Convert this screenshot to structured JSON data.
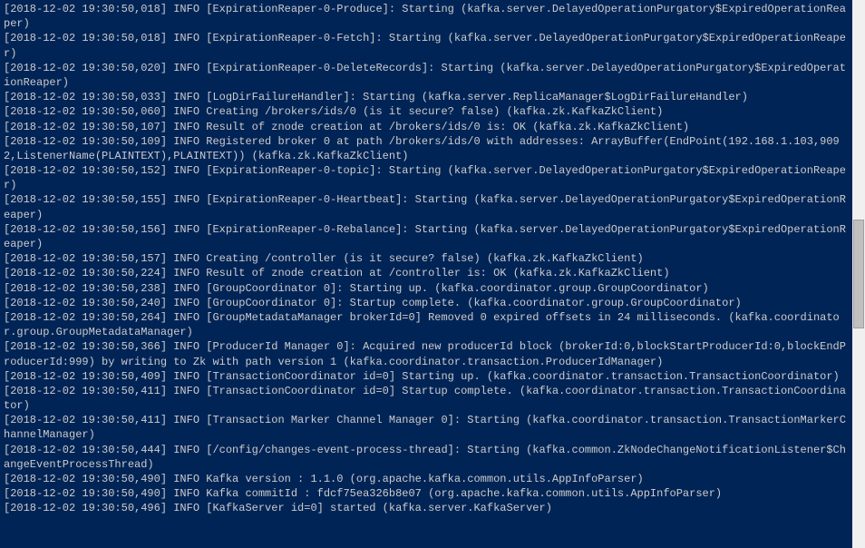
{
  "log_lines": [
    "[2018-12-02 19:30:50,018] INFO [ExpirationReaper-0-Produce]: Starting (kafka.server.DelayedOperationPurgatory$ExpiredOperationReaper)",
    "[2018-12-02 19:30:50,018] INFO [ExpirationReaper-0-Fetch]: Starting (kafka.server.DelayedOperationPurgatory$ExpiredOperationReaper)",
    "[2018-12-02 19:30:50,020] INFO [ExpirationReaper-0-DeleteRecords]: Starting (kafka.server.DelayedOperationPurgatory$ExpiredOperationReaper)",
    "[2018-12-02 19:30:50,033] INFO [LogDirFailureHandler]: Starting (kafka.server.ReplicaManager$LogDirFailureHandler)",
    "[2018-12-02 19:30:50,060] INFO Creating /brokers/ids/0 (is it secure? false) (kafka.zk.KafkaZkClient)",
    "[2018-12-02 19:30:50,107] INFO Result of znode creation at /brokers/ids/0 is: OK (kafka.zk.KafkaZkClient)",
    "[2018-12-02 19:30:50,109] INFO Registered broker 0 at path /brokers/ids/0 with addresses: ArrayBuffer(EndPoint(192.168.1.103,9092,ListenerName(PLAINTEXT),PLAINTEXT)) (kafka.zk.KafkaZkClient)",
    "[2018-12-02 19:30:50,152] INFO [ExpirationReaper-0-topic]: Starting (kafka.server.DelayedOperationPurgatory$ExpiredOperationReaper)",
    "[2018-12-02 19:30:50,155] INFO [ExpirationReaper-0-Heartbeat]: Starting (kafka.server.DelayedOperationPurgatory$ExpiredOperationReaper)",
    "[2018-12-02 19:30:50,156] INFO [ExpirationReaper-0-Rebalance]: Starting (kafka.server.DelayedOperationPurgatory$ExpiredOperationReaper)",
    "[2018-12-02 19:30:50,157] INFO Creating /controller (is it secure? false) (kafka.zk.KafkaZkClient)",
    "[2018-12-02 19:30:50,224] INFO Result of znode creation at /controller is: OK (kafka.zk.KafkaZkClient)",
    "[2018-12-02 19:30:50,238] INFO [GroupCoordinator 0]: Starting up. (kafka.coordinator.group.GroupCoordinator)",
    "[2018-12-02 19:30:50,240] INFO [GroupCoordinator 0]: Startup complete. (kafka.coordinator.group.GroupCoordinator)",
    "[2018-12-02 19:30:50,264] INFO [GroupMetadataManager brokerId=0] Removed 0 expired offsets in 24 milliseconds. (kafka.coordinator.group.GroupMetadataManager)",
    "[2018-12-02 19:30:50,366] INFO [ProducerId Manager 0]: Acquired new producerId block (brokerId:0,blockStartProducerId:0,blockEndProducerId:999) by writing to Zk with path version 1 (kafka.coordinator.transaction.ProducerIdManager)",
    "[2018-12-02 19:30:50,409] INFO [TransactionCoordinator id=0] Starting up. (kafka.coordinator.transaction.TransactionCoordinator)",
    "[2018-12-02 19:30:50,411] INFO [TransactionCoordinator id=0] Startup complete. (kafka.coordinator.transaction.TransactionCoordinator)",
    "[2018-12-02 19:30:50,411] INFO [Transaction Marker Channel Manager 0]: Starting (kafka.coordinator.transaction.TransactionMarkerChannelManager)",
    "[2018-12-02 19:30:50,444] INFO [/config/changes-event-process-thread]: Starting (kafka.common.ZkNodeChangeNotificationListener$ChangeEventProcessThread)",
    "[2018-12-02 19:30:50,490] INFO Kafka version : 1.1.0 (org.apache.kafka.common.utils.AppInfoParser)",
    "[2018-12-02 19:30:50,490] INFO Kafka commitId : fdcf75ea326b8e07 (org.apache.kafka.common.utils.AppInfoParser)",
    "[2018-12-02 19:30:50,496] INFO [KafkaServer id=0] started (kafka.server.KafkaServer)"
  ]
}
